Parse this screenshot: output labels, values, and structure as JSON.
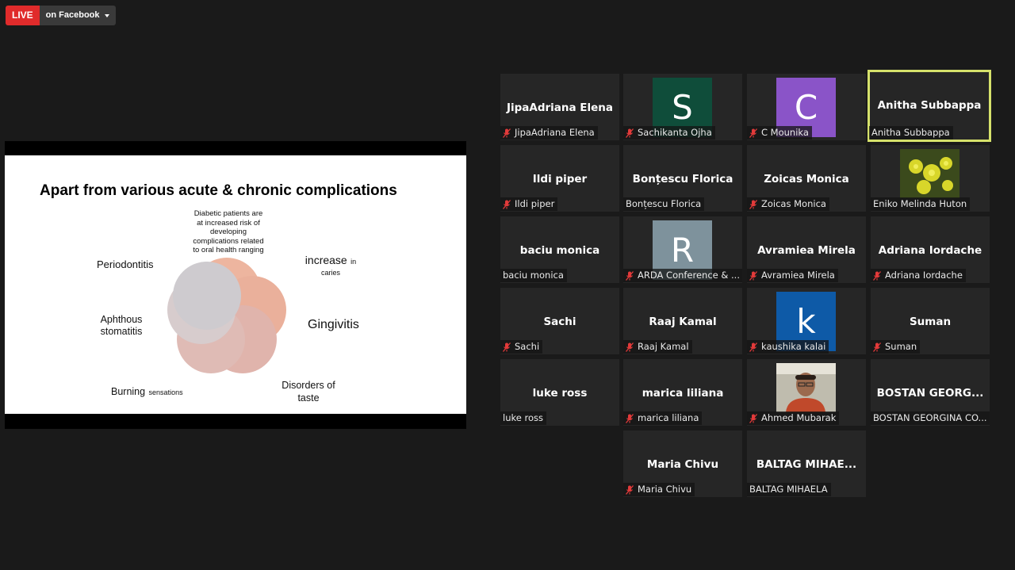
{
  "live": {
    "badge": "LIVE",
    "target": "on Facebook"
  },
  "slide": {
    "title": "Apart from various acute & chronic complications",
    "center_note": [
      "Diabetic patients are",
      "at increased risk of",
      "developing",
      "complications related",
      "to oral health ranging"
    ],
    "labels": {
      "periodontitis": "Periodontitis",
      "increase": "increase",
      "increase_small": "in",
      "caries": "caries",
      "aphthous_1": "Aphthous",
      "aphthous_2": "stomatitis",
      "gingivitis": "Gingivitis",
      "disorders_1": "Disorders of",
      "disorders_2": "taste",
      "burning": "Burning",
      "burning_small": "sensations"
    }
  },
  "participants": [
    {
      "name": "JipaAdriana  Elena",
      "label": "JipaAdriana Elena",
      "muted": true
    },
    {
      "name": "",
      "label": "Sachikanta Ojha",
      "muted": true,
      "avatar": "S",
      "avatar_color": "#0f4d3a"
    },
    {
      "name": "",
      "label": "C Mounika",
      "muted": true,
      "avatar": "C",
      "avatar_color": "#8a54c8"
    },
    {
      "name": "Anitha Subbappa",
      "label": "Anitha Subbappa",
      "muted": false,
      "active": true
    },
    {
      "name": "Ildi piper",
      "label": "Ildi piper",
      "muted": true
    },
    {
      "name": "Bonțescu Florica",
      "label": "Bonțescu Florica",
      "muted": false
    },
    {
      "name": "Zoicas Monica",
      "label": "Zoicas Monica",
      "muted": true
    },
    {
      "name": "",
      "label": "Eniko Melinda Huton",
      "muted": false,
      "photo": "flower"
    },
    {
      "name": "baciu monica",
      "label": "baciu monica",
      "muted": false
    },
    {
      "name": "",
      "label": "ARDA Conference & ...",
      "muted": true,
      "avatar": "R",
      "avatar_color": "#7e929c"
    },
    {
      "name": "Avramiea Mirela",
      "label": "Avramiea Mirela",
      "muted": true
    },
    {
      "name": "Adriana Iordache",
      "label": "Adriana Iordache",
      "muted": true
    },
    {
      "name": "Sachi",
      "label": "Sachi",
      "muted": true
    },
    {
      "name": "Raaj Kamal",
      "label": "Raaj Kamal",
      "muted": true
    },
    {
      "name": "",
      "label": "kaushika kalai",
      "muted": true,
      "avatar": "k",
      "avatar_color": "#0e5aa7"
    },
    {
      "name": "Suman",
      "label": "Suman",
      "muted": true
    },
    {
      "name": "luke ross",
      "label": "luke ross",
      "muted": false
    },
    {
      "name": "marica liliana",
      "label": "marica liliana",
      "muted": true
    },
    {
      "name": "",
      "label": "Ahmed Mubarak",
      "muted": true,
      "photo": "person"
    },
    {
      "name": "BOSTAN  GEORG...",
      "label": "BOSTAN GEORGINA CO...",
      "muted": false
    },
    {
      "name": "Maria Chivu",
      "label": "Maria Chivu",
      "muted": true
    },
    {
      "name": "BALTAG MIHAE...",
      "label": "BALTAG MIHAELA",
      "muted": false
    }
  ]
}
